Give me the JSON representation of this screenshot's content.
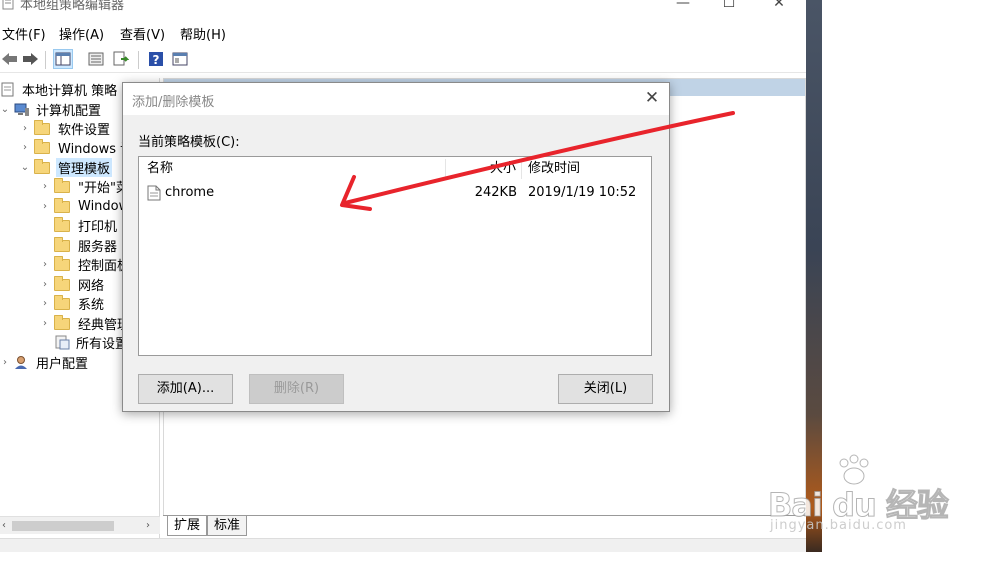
{
  "window": {
    "title": "本地组策略编辑器",
    "controls": {
      "minimize": "—",
      "maximize": "☐",
      "close": "✕"
    }
  },
  "menubar": {
    "items": [
      {
        "label": "文件(F)"
      },
      {
        "label": "操作(A)"
      },
      {
        "label": "查看(V)"
      },
      {
        "label": "帮助(H)"
      }
    ]
  },
  "toolbar": {
    "icons": [
      "back-arrow-icon",
      "forward-arrow-icon",
      "show-hide-tree-icon",
      "properties-icon",
      "export-list-icon",
      "help-icon",
      "extended-view-icon"
    ]
  },
  "tree": {
    "root": "本地计算机 策略",
    "computer_config": "计算机配置",
    "software_settings": "软件设置",
    "windows_settings": "Windows 设",
    "admin_templates": "管理模板",
    "start_menu": "\"开始\"菜",
    "windows_components": "Window",
    "printers": "打印机",
    "servers": "服务器",
    "control_panel": "控制面板",
    "network": "网络",
    "system": "系统",
    "classic_templates": "经典管理",
    "all_settings": "所有设置",
    "user_config": "用户配置"
  },
  "tabs": {
    "extended": "扩展",
    "standard": "标准"
  },
  "dialog": {
    "title": "添加/删除模板",
    "close_glyph": "✕",
    "list_label": "当前策略模板(C):",
    "columns": {
      "name": "名称",
      "size": "大小",
      "modified": "修改时间"
    },
    "rows": [
      {
        "name": "chrome",
        "size": "242KB",
        "modified": "2019/1/19 10:52"
      }
    ],
    "buttons": {
      "add": "添加(A)...",
      "remove": "删除(R)",
      "close": "关闭(L)"
    }
  },
  "watermark": {
    "brand": "Bai du 经验",
    "url": "jingyan.baidu.com"
  },
  "colors": {
    "annotation_arrow": "#e8242c",
    "selection": "#cde8ff",
    "right_header": "#c0d3e6",
    "folder": "#f6d57a"
  }
}
